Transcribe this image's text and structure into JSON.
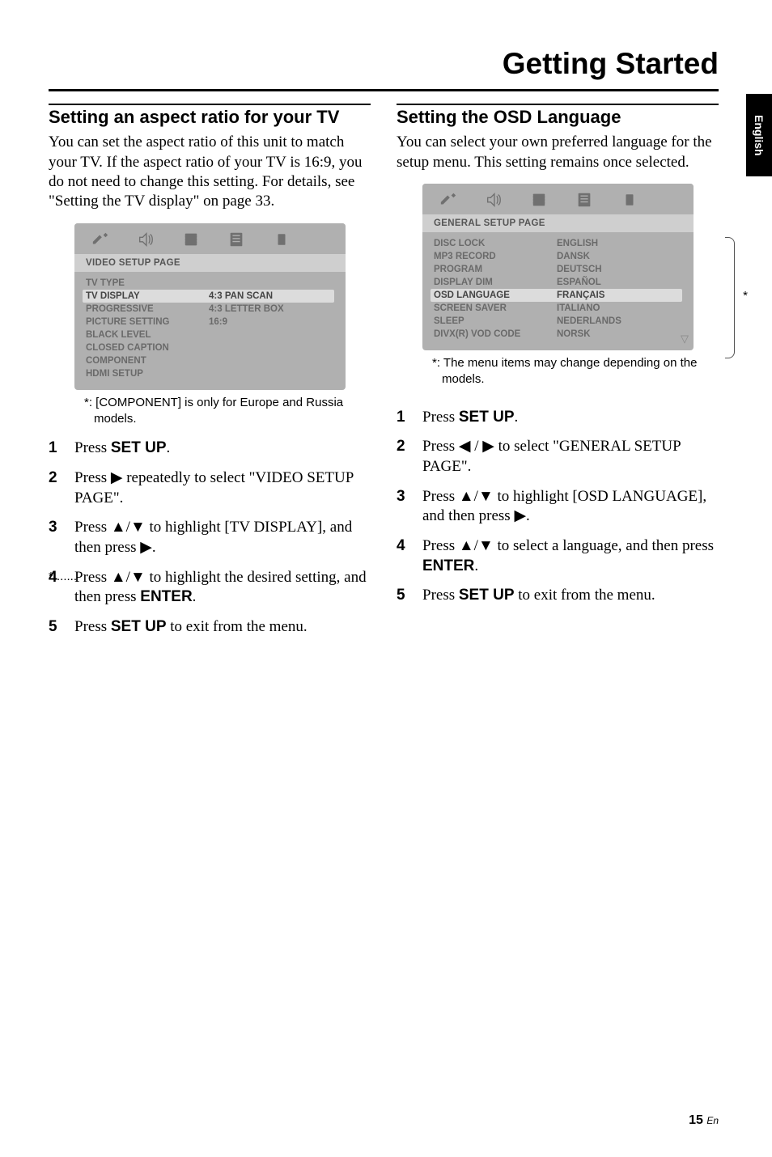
{
  "header": {
    "title": "Getting Started"
  },
  "side_tab": "English",
  "left": {
    "heading": "Setting an aspect ratio for your TV",
    "body": "You can set the aspect ratio of this unit to match your TV. If the aspect ratio of your TV is 16:9, you do not need to change this setting. For details, see \"Setting the TV display\" on page 33.",
    "menu": {
      "title": "VIDEO SETUP PAGE",
      "rows": [
        {
          "lbl": "TV TYPE",
          "val": ""
        },
        {
          "lbl": "TV DISPLAY",
          "val": "4:3 PAN SCAN",
          "hl": true
        },
        {
          "lbl": "PROGRESSIVE",
          "val": "4:3 LETTER BOX"
        },
        {
          "lbl": "PICTURE SETTING",
          "val": "16:9"
        },
        {
          "lbl": "BLACK LEVEL",
          "val": ""
        },
        {
          "lbl": "CLOSED CAPTION",
          "val": ""
        },
        {
          "lbl": "COMPONENT",
          "val": ""
        },
        {
          "lbl": "HDMI SETUP",
          "val": ""
        }
      ]
    },
    "note": "*: [COMPONENT] is only for Europe and Russia models.",
    "star_marker": "*",
    "steps": {
      "s1a": "Press ",
      "s1b": "SET UP",
      "s1c": ".",
      "s2": "Press ▶ repeatedly to select \"VIDEO SETUP PAGE\".",
      "s3": "Press ▲/▼ to highlight [TV DISPLAY], and then press ▶.",
      "s4a": "Press ▲/▼ to highlight the desired setting, and then press ",
      "s4b": "ENTER",
      "s4c": ".",
      "s5a": "Press ",
      "s5b": "SET UP",
      "s5c": " to exit from the menu."
    }
  },
  "right": {
    "heading": "Setting the OSD Language",
    "body": "You can select your own preferred language for the setup menu. This setting remains once selected.",
    "menu": {
      "title": "GENERAL SETUP PAGE",
      "rows": [
        {
          "lbl": "DISC LOCK",
          "val": "ENGLISH"
        },
        {
          "lbl": "MP3 RECORD",
          "val": "DANSK"
        },
        {
          "lbl": "PROGRAM",
          "val": "DEUTSCH"
        },
        {
          "lbl": "DISPLAY DIM",
          "val": "ESPAÑOL"
        },
        {
          "lbl": "OSD LANGUAGE",
          "val": "FRANÇAIS",
          "hl": true
        },
        {
          "lbl": "SCREEN SAVER",
          "val": "ITALIANO"
        },
        {
          "lbl": "SLEEP",
          "val": "NEDERLANDS"
        },
        {
          "lbl": "DIVX(R) VOD CODE",
          "val": "NORSK"
        }
      ]
    },
    "note": "*: The menu items may change depending on the models.",
    "star_marker": "*",
    "steps": {
      "s1a": "Press ",
      "s1b": "SET UP",
      "s1c": ".",
      "s2": "Press ◀ / ▶ to select \"GENERAL SETUP PAGE\".",
      "s3": "Press ▲/▼ to highlight [OSD LANGUAGE], and then press ▶.",
      "s4a": "Press ▲/▼ to select a language, and then press ",
      "s4b": "ENTER",
      "s4c": ".",
      "s5a": "Press ",
      "s5b": "SET UP",
      "s5c": " to exit from the menu."
    }
  },
  "footer": {
    "page": "15",
    "suffix": "En"
  },
  "icons": {
    "wrench": "wrench-icon",
    "speaker": "speaker-icon",
    "film": "film-icon",
    "list": "list-icon",
    "rect": "rect-icon",
    "down": "▽"
  }
}
